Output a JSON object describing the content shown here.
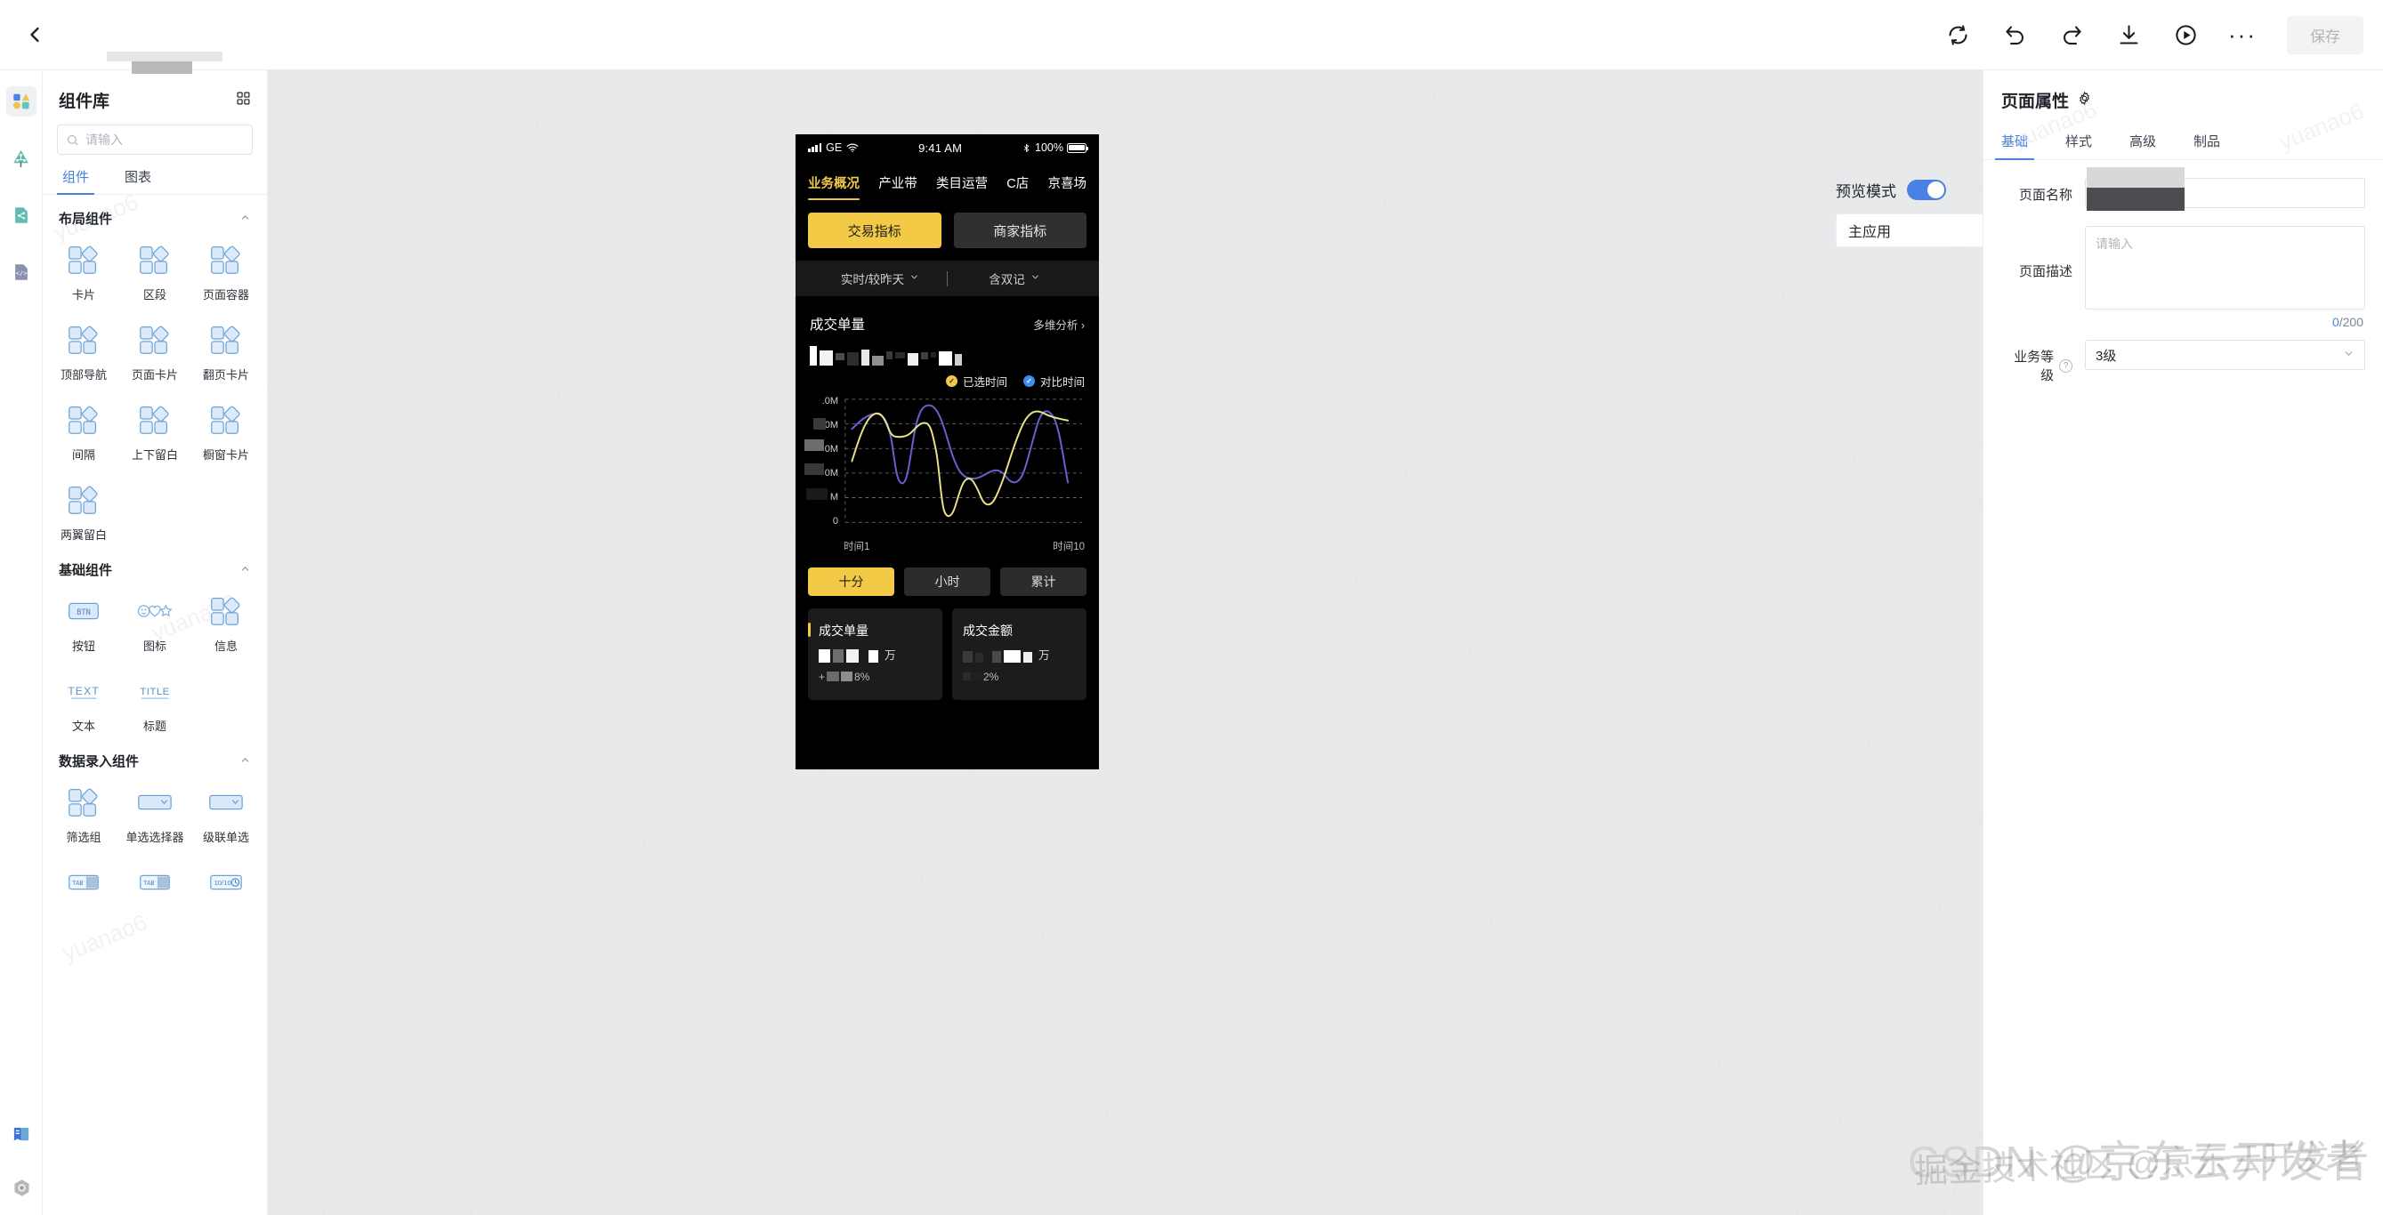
{
  "topbar": {
    "back_icon": "chevron-left-icon",
    "title_redacted": true,
    "actions": [
      {
        "name": "sync-icon",
        "label": "同步"
      },
      {
        "name": "undo-icon",
        "label": "撤销"
      },
      {
        "name": "redo-icon",
        "label": "重做"
      },
      {
        "name": "download-icon",
        "label": "下载"
      },
      {
        "name": "play-icon",
        "label": "预览运行"
      },
      {
        "name": "more-icon",
        "label": "更多"
      }
    ],
    "save_label": "保存"
  },
  "rail": {
    "items": [
      {
        "name": "components-icon",
        "label": "组件",
        "selected": true
      },
      {
        "name": "tree-icon",
        "label": "结构树",
        "selected": false
      },
      {
        "name": "flow-icon",
        "label": "流程",
        "selected": false
      },
      {
        "name": "code-icon",
        "label": "代码",
        "selected": false
      }
    ],
    "bottom": [
      {
        "name": "manual-icon",
        "label": "手册"
      },
      {
        "name": "settings-icon",
        "label": "设置"
      }
    ]
  },
  "library": {
    "title": "组件库",
    "grid_toggle_icon": "grid-view-icon",
    "search": {
      "placeholder": "请输入",
      "value": ""
    },
    "tabs": [
      {
        "label": "组件",
        "active": true
      },
      {
        "label": "图表",
        "active": false
      }
    ],
    "sections": [
      {
        "title": "布局组件",
        "collapsed": false,
        "items": [
          {
            "label": "卡片",
            "icon": "squares-diamond-icon"
          },
          {
            "label": "区段",
            "icon": "squares-diamond-icon"
          },
          {
            "label": "页面容器",
            "icon": "squares-diamond-icon"
          },
          {
            "label": "顶部导航",
            "icon": "squares-diamond-icon"
          },
          {
            "label": "页面卡片",
            "icon": "squares-diamond-icon"
          },
          {
            "label": "翻页卡片",
            "icon": "squares-diamond-icon"
          },
          {
            "label": "间隔",
            "icon": "squares-diamond-icon"
          },
          {
            "label": "上下留白",
            "icon": "squares-diamond-icon"
          },
          {
            "label": "橱窗卡片",
            "icon": "squares-diamond-icon"
          },
          {
            "label": "两翼留白",
            "icon": "squares-diamond-icon"
          }
        ]
      },
      {
        "title": "基础组件",
        "collapsed": false,
        "items": [
          {
            "label": "按钮",
            "icon": "btn-icon",
            "glyph": "BTN"
          },
          {
            "label": "图标",
            "icon": "emoji-icons-icon",
            "glyph": ""
          },
          {
            "label": "信息",
            "icon": "squares-diamond-icon"
          },
          {
            "label": "文本",
            "icon": "text-icon",
            "glyph": "TEXT"
          },
          {
            "label": "标题",
            "icon": "title-icon",
            "glyph": "TITLE"
          }
        ]
      },
      {
        "title": "数据录入组件",
        "collapsed": false,
        "items": [
          {
            "label": "筛选组",
            "icon": "squares-diamond-icon"
          },
          {
            "label": "单选选择器",
            "icon": "select-icon"
          },
          {
            "label": "级联单选",
            "icon": "select-icon"
          },
          {
            "label": "",
            "icon": "tab-icon",
            "glyph": "TAB"
          },
          {
            "label": "",
            "icon": "tab-icon",
            "glyph": "TAB"
          },
          {
            "label": "",
            "icon": "timer-icon",
            "glyph": "10/10"
          }
        ]
      }
    ]
  },
  "canvas": {
    "preview_mode_label": "预览模式",
    "preview_mode_on": true,
    "app_select": {
      "value": "主应用",
      "chevron": "chevron-down-icon"
    }
  },
  "phone": {
    "status_bar": {
      "carrier": "GE",
      "signal_icon": "signal-bars-icon",
      "wifi_icon": "wifi-icon",
      "time": "9:41 AM",
      "bluetooth_icon": "bluetooth-icon",
      "battery_percent": "100%",
      "battery_icon": "battery-full-icon"
    },
    "tabs": [
      {
        "label": "业务概况",
        "active": true
      },
      {
        "label": "产业带",
        "active": false
      },
      {
        "label": "类目运营",
        "active": false
      },
      {
        "label": "C店",
        "active": false
      },
      {
        "label": "京喜场",
        "active": false
      }
    ],
    "segment_primary": [
      {
        "label": "交易指标",
        "active": true
      },
      {
        "label": "商家指标",
        "active": false
      }
    ],
    "filters": [
      {
        "label": "实时/较昨天",
        "chevron": "chevron-down-icon"
      },
      {
        "label": "含双记",
        "chevron": "chevron-down-icon"
      }
    ],
    "card": {
      "title": "成交单量",
      "more_label": "多维分析",
      "more_chevron": "chevron-right-icon",
      "value_redacted": true
    },
    "segment_time": [
      {
        "label": "十分",
        "active": true
      },
      {
        "label": "小时",
        "active": false
      },
      {
        "label": "累计",
        "active": false
      }
    ],
    "kpis": [
      {
        "title": "成交单量",
        "value_redacted": true,
        "unit": "万",
        "delta_suffix": "8%",
        "delta_prefix": "+",
        "accent": true
      },
      {
        "title": "成交金额",
        "value_redacted": true,
        "unit": "万",
        "delta_suffix": "2%",
        "delta_prefix": "",
        "accent": false
      }
    ]
  },
  "chart_data": {
    "type": "line",
    "title": "成交单量",
    "xlabel": "",
    "ylabel": "",
    "grid": true,
    "legend_position": "top-right",
    "x_tick_labels": [
      "时间1",
      "时间10"
    ],
    "y_tick_labels": [
      ".0M",
      ".0M",
      "0M",
      "0M",
      "M",
      "0"
    ],
    "y_labels_redacted": true,
    "ylim": [
      0,
      6
    ],
    "x": [
      1,
      2,
      3,
      4,
      5,
      6,
      7,
      8,
      9,
      10
    ],
    "series": [
      {
        "name": "已选时间",
        "color": "#e8e08a",
        "legend_icon": "check-circle-icon",
        "values": [
          2.6,
          4.7,
          4.1,
          4.35,
          0.5,
          1.55,
          0.75,
          3.1,
          4.75,
          4.55
        ]
      },
      {
        "name": "对比时间",
        "color": "#6b5fd4",
        "legend_icon": "check-circle-icon",
        "values": [
          4.0,
          4.6,
          1.35,
          5.05,
          3.9,
          2.0,
          2.3,
          1.9,
          4.6,
          1.55
        ]
      }
    ]
  },
  "props": {
    "title": "页面属性",
    "gear_icon": "gear-icon",
    "tabs": [
      {
        "label": "基础",
        "active": true
      },
      {
        "label": "样式",
        "active": false
      },
      {
        "label": "高级",
        "active": false
      },
      {
        "label": "制品",
        "active": false
      }
    ],
    "fields": {
      "page_name_label": "页面名称",
      "page_name_value_redacted": true,
      "page_desc_label": "页面描述",
      "page_desc_placeholder": "请输入",
      "page_desc_count": "0",
      "page_desc_max": "/200",
      "biz_level_label": "业务等级",
      "biz_level_help_icon": "question-circle-icon",
      "biz_level_value": "3级",
      "biz_level_chevron": "chevron-down-icon"
    }
  },
  "watermarks": {
    "csdn": "CSDN @京东云开发者",
    "juejin": "掘金技术社区 @京东云开发者"
  }
}
